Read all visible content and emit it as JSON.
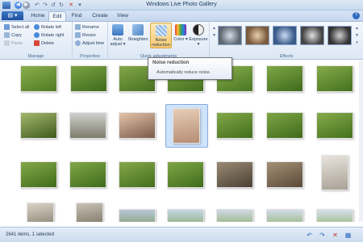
{
  "window": {
    "title": "Windows Live Photo Gallery"
  },
  "tabs": [
    {
      "label": "Home"
    },
    {
      "label": "Edit"
    },
    {
      "label": "Find"
    },
    {
      "label": "Create"
    },
    {
      "label": "View"
    }
  ],
  "ribbon": {
    "manage": {
      "label": "Manage",
      "select_all": "Select all",
      "copy": "Copy",
      "paste": "Paste",
      "rotate_left": "Rotate left",
      "rotate_right": "Rotate right",
      "delete": "Delete"
    },
    "properties": {
      "label": "Properties",
      "rename": "Rename",
      "resize": "Resize",
      "adjust_time": "Adjust time"
    },
    "quick_adjustments": {
      "label": "Quick adjustments",
      "auto_adjust": "Auto adjust",
      "straighten": "Straighten",
      "noise_reduction": "Noise reduction",
      "color": "Color",
      "exposure": "Exposure"
    },
    "effects": {
      "label": "Effects"
    }
  },
  "tooltip": {
    "title": "Noise reduction",
    "body": "Automatically reduce noise."
  },
  "status": {
    "text": "2641 items, 1 selected"
  },
  "colors": {
    "accent": "#3f78c8",
    "selection": "#cfe3fb",
    "grass": "#5d8a2f"
  }
}
